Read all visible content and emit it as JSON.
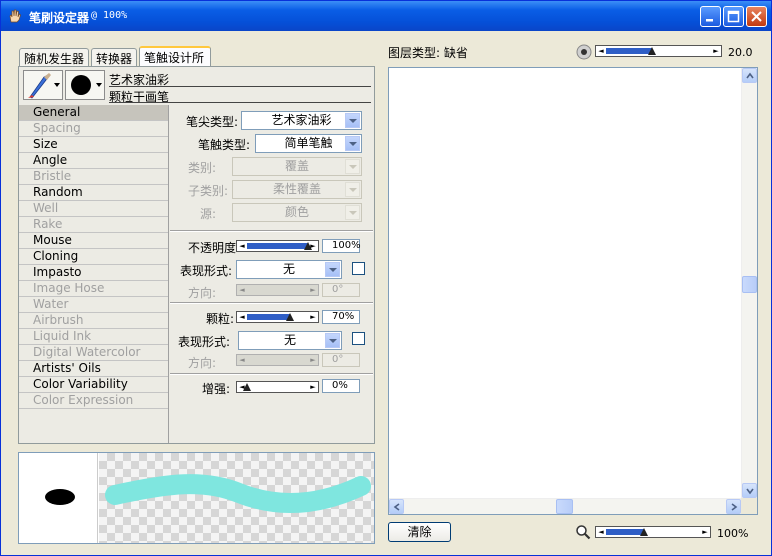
{
  "window": {
    "title": "笔刷设定器",
    "zoom_suffix": "@ 100%"
  },
  "tabs": [
    "随机发生器",
    "转换器",
    "笔触设计所"
  ],
  "brush": {
    "variant_category": "艺术家油彩",
    "variant_name": "颗粒干画笔"
  },
  "categories": [
    {
      "label": "General",
      "enabled": true,
      "selected": true
    },
    {
      "label": "Spacing",
      "enabled": false
    },
    {
      "label": "Size",
      "enabled": true
    },
    {
      "label": "Angle",
      "enabled": true
    },
    {
      "label": "Bristle",
      "enabled": false
    },
    {
      "label": "Random",
      "enabled": true
    },
    {
      "label": "Well",
      "enabled": false
    },
    {
      "label": "Rake",
      "enabled": false
    },
    {
      "label": "Mouse",
      "enabled": true
    },
    {
      "label": "Cloning",
      "enabled": true
    },
    {
      "label": "Impasto",
      "enabled": true
    },
    {
      "label": "Image Hose",
      "enabled": false
    },
    {
      "label": "Water",
      "enabled": false
    },
    {
      "label": "Airbrush",
      "enabled": false
    },
    {
      "label": "Liquid Ink",
      "enabled": false
    },
    {
      "label": "Digital Watercolor",
      "enabled": false
    },
    {
      "label": "Artists' Oils",
      "enabled": true
    },
    {
      "label": "Color Variability",
      "enabled": true
    },
    {
      "label": "Color Expression",
      "enabled": false
    }
  ],
  "general": {
    "dab_type": {
      "label": "笔尖类型:",
      "value": "艺术家油彩"
    },
    "stroke_type": {
      "label": "笔触类型:",
      "value": "简单笔触"
    },
    "method": {
      "label": "类别:",
      "value": "覆盖"
    },
    "subcategory": {
      "label": "子类别:",
      "value": "柔性覆盖"
    },
    "source": {
      "label": "源:",
      "value": "颜色"
    },
    "opacity": {
      "label": "不透明度",
      "value": "100%",
      "level": 1.0
    },
    "opacity_expression": {
      "label": "表现形式:",
      "value": "无"
    },
    "opacity_direction": {
      "label": "方向:",
      "value": "0°"
    },
    "grain": {
      "label": "颗粒:",
      "value": "70%",
      "level": 0.7
    },
    "grain_expression": {
      "label": "表现形式:",
      "value": "无"
    },
    "grain_direction": {
      "label": "方向:",
      "value": "0°"
    },
    "boost": {
      "label": "增强:",
      "value": "0%",
      "level": 0.0
    }
  },
  "right": {
    "layer_type": "图层类型: 缺省",
    "size_value": "20.0",
    "size_level": 0.44,
    "clear_label": "清除",
    "zoom_value": "100%",
    "zoom_level": 0.4
  },
  "colors": {
    "stroke": "#7fe6df",
    "title_bar": "#0a5ee6",
    "slider_fill": "#2f5ec6"
  }
}
